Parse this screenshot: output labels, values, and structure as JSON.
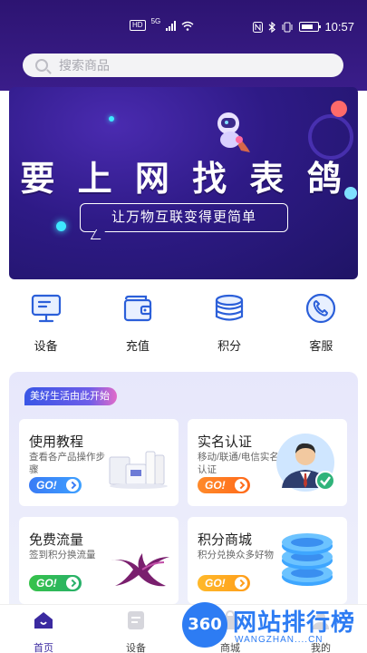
{
  "status_bar": {
    "left_indicators": [
      "HD",
      "5G"
    ],
    "time": "10:57",
    "icons": [
      "hd-icon",
      "signal-icon",
      "wifi-icon",
      "nfc-icon",
      "bluetooth-icon",
      "vibrate-icon",
      "battery-icon"
    ]
  },
  "search": {
    "placeholder": "搜索商品"
  },
  "banner": {
    "title": "要 上 网 找 表 鸽",
    "subtitle": "让万物互联变得更简单"
  },
  "shortcuts": [
    {
      "label": "设备",
      "icon": "monitor-icon"
    },
    {
      "label": "充值",
      "icon": "wallet-icon"
    },
    {
      "label": "积分",
      "icon": "coin-stack-icon"
    },
    {
      "label": "客服",
      "icon": "phone-icon"
    }
  ],
  "promo": {
    "tag": "美好生活由此开始",
    "cards": [
      {
        "title": "使用教程",
        "desc": "查看各产品操作步骤",
        "go": "GO!",
        "color": "#3a7bf5",
        "art": "devices-art"
      },
      {
        "title": "实名认证",
        "desc": "移动/联通/电信实名认证",
        "go": "GO!",
        "color": "#ff6a1a",
        "art": "verified-user-art"
      },
      {
        "title": "免费流量",
        "desc": "签到积分换流量",
        "go": "GO!",
        "color": "#28b06a",
        "art": "bird-logo-art"
      },
      {
        "title": "积分商城",
        "desc": "积分兑换众多好物",
        "go": "GO!",
        "color": "#ff9d1a",
        "art": "coin-stack-art"
      }
    ]
  },
  "bottom_nav": [
    {
      "label": "首页",
      "icon": "home-icon",
      "active": true
    },
    {
      "label": "设备",
      "icon": "device-icon",
      "active": false
    },
    {
      "label": "商城",
      "icon": "mall-icon",
      "active": false
    },
    {
      "label": "我的",
      "icon": "profile-icon",
      "active": false
    }
  ],
  "watermark": {
    "badge": "360",
    "text": "网站排行榜",
    "url": "WANGZHAN....CN"
  },
  "colors": {
    "header": "#2d1472",
    "accent": "#3b2aa0",
    "icon_blue": "#2b5fd9"
  }
}
